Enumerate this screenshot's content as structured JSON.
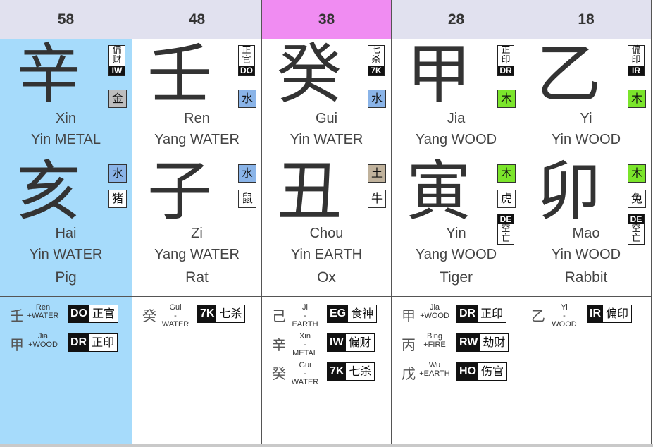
{
  "colors": {
    "highlight_col": "#a6dbfb",
    "current_header": "#f08cf2",
    "header": "#e1e1ef",
    "metal": "#bdbdbd",
    "water": "#8ab4e8",
    "wood": "#7be52b",
    "earth": "#c0b29c"
  },
  "pillars": [
    {
      "age": "58",
      "stem": {
        "char": "辛",
        "pinyin": "Xin",
        "desc": "Yin METAL",
        "god_chars": "偏财",
        "god_code": "IW",
        "element_char": "金",
        "element": "metal"
      },
      "branch": {
        "char": "亥",
        "pinyin": "Hai",
        "desc": "Yin WATER",
        "animal": "Pig",
        "element_char": "水",
        "element": "water",
        "animal_char": "猪",
        "void": false
      },
      "hidden": [
        {
          "char": "壬",
          "label1": "Ren",
          "label2": "+WATER",
          "code": "DO",
          "god": "正官"
        },
        {
          "char": "甲",
          "label1": "Jia",
          "label2": "+WOOD",
          "code": "DR",
          "god": "正印"
        }
      ]
    },
    {
      "age": "48",
      "stem": {
        "char": "壬",
        "pinyin": "Ren",
        "desc": "Yang WATER",
        "god_chars": "正官",
        "god_code": "DO",
        "element_char": "水",
        "element": "water"
      },
      "branch": {
        "char": "子",
        "pinyin": "Zi",
        "desc": "Yang WATER",
        "animal": "Rat",
        "element_char": "水",
        "element": "water",
        "animal_char": "鼠",
        "void": false
      },
      "hidden": [
        {
          "char": "癸",
          "label1": "Gui",
          "label2": "-",
          "label3": "WATER",
          "code": "7K",
          "god": "七杀"
        }
      ]
    },
    {
      "age": "38",
      "stem": {
        "char": "癸",
        "pinyin": "Gui",
        "desc": "Yin WATER",
        "god_chars": "七杀",
        "god_code": "7K",
        "element_char": "水",
        "element": "water"
      },
      "branch": {
        "char": "丑",
        "pinyin": "Chou",
        "desc": "Yin EARTH",
        "animal": "Ox",
        "element_char": "土",
        "element": "earth",
        "animal_char": "牛",
        "void": false
      },
      "hidden": [
        {
          "char": "己",
          "label1": "Ji",
          "label2": "-",
          "label3": "EARTH",
          "code": "EG",
          "god": "食神"
        },
        {
          "char": "辛",
          "label1": "Xin",
          "label2": "-",
          "label3": "METAL",
          "code": "IW",
          "god": "偏财"
        },
        {
          "char": "癸",
          "label1": "Gui",
          "label2": "-",
          "label3": "WATER",
          "code": "7K",
          "god": "七杀"
        }
      ]
    },
    {
      "age": "28",
      "stem": {
        "char": "甲",
        "pinyin": "Jia",
        "desc": "Yang WOOD",
        "god_chars": "正印",
        "god_code": "DR",
        "element_char": "木",
        "element": "wood"
      },
      "branch": {
        "char": "寅",
        "pinyin": "Yin",
        "desc": "Yang WOOD",
        "animal": "Tiger",
        "element_char": "木",
        "element": "wood",
        "animal_char": "虎",
        "void": true,
        "void_code": "DE",
        "void_chars": "空亡"
      },
      "hidden": [
        {
          "char": "甲",
          "label1": "Jia",
          "label2": "+WOOD",
          "code": "DR",
          "god": "正印"
        },
        {
          "char": "丙",
          "label1": "Bing",
          "label2": "+FIRE",
          "code": "RW",
          "god": "劫财"
        },
        {
          "char": "戊",
          "label1": "Wu",
          "label2": "+EARTH",
          "code": "HO",
          "god": "伤官"
        }
      ]
    },
    {
      "age": "18",
      "stem": {
        "char": "乙",
        "pinyin": "Yi",
        "desc": "Yin WOOD",
        "god_chars": "偏印",
        "god_code": "IR",
        "element_char": "木",
        "element": "wood"
      },
      "branch": {
        "char": "卯",
        "pinyin": "Mao",
        "desc": "Yin WOOD",
        "animal": "Rabbit",
        "element_char": "木",
        "element": "wood",
        "animal_char": "兔",
        "void": true,
        "void_code": "DE",
        "void_chars": "空亡"
      },
      "hidden": [
        {
          "char": "乙",
          "label1": "Yi",
          "label2": "-",
          "label3": "WOOD",
          "code": "IR",
          "god": "偏印"
        }
      ]
    }
  ]
}
